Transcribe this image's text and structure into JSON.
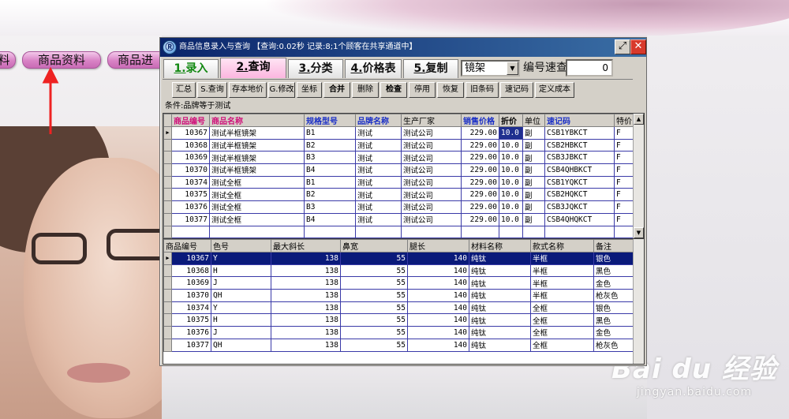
{
  "background": {
    "nav_buttons": [
      "料",
      "商品资料",
      "商品进"
    ],
    "watermark_text": "Bai du 经验",
    "watermark_url": "jingyan.baidu.com"
  },
  "window": {
    "title": "商品信息录入与查询  【查询:0.02秒  记录:8;1个顾客在共享通道中】",
    "icon": "app-logo-icon",
    "controls": {
      "restore": "restore-icon",
      "close": "close-icon"
    }
  },
  "tabs": [
    {
      "num": "1.",
      "label": "录入"
    },
    {
      "num": "2.",
      "label": "查询"
    },
    {
      "num": "3.",
      "label": "分类"
    },
    {
      "num": "4.",
      "label": "价格表"
    },
    {
      "num": "5.",
      "label": "复制"
    }
  ],
  "category_combo": {
    "value": "镜架"
  },
  "quick_search": {
    "label": "编号速查",
    "value": "0"
  },
  "toolbar": [
    {
      "name": "summary-button",
      "label": "汇总"
    },
    {
      "name": "query-button",
      "label": "S.查询"
    },
    {
      "name": "save-cost-button",
      "label": "存本地价"
    },
    {
      "name": "modify-button",
      "label": "G.修改"
    },
    {
      "name": "coordinate-button",
      "label": "坐标"
    },
    {
      "name": "merge-button",
      "label": "合并"
    },
    {
      "name": "delete-button",
      "label": "删除"
    },
    {
      "name": "check-button",
      "label": "检查"
    },
    {
      "name": "disable-button",
      "label": "停用"
    },
    {
      "name": "restore-button",
      "label": "恢复"
    },
    {
      "name": "old-barcode-button",
      "label": "旧条码"
    },
    {
      "name": "quick-code-button",
      "label": "速记码"
    },
    {
      "name": "define-cost-button",
      "label": "定义成本"
    }
  ],
  "condition": "条件:品牌等于测试",
  "top_grid": {
    "headers": [
      "商品编号",
      "商品名称",
      "规格型号",
      "品牌名称",
      "生产厂家",
      "销售价格",
      "折价",
      "单位",
      "速记码",
      "特价"
    ],
    "rows": [
      [
        "10367",
        "测试半框镜架",
        "B1",
        "测试",
        "测试公司",
        "229.00",
        "10.0",
        "副",
        "CSB1YBKCT",
        "F"
      ],
      [
        "10368",
        "测试半框镜架",
        "B2",
        "测试",
        "测试公司",
        "229.00",
        "10.0",
        "副",
        "CSB2HBKCT",
        "F"
      ],
      [
        "10369",
        "测试半框镜架",
        "B3",
        "测试",
        "测试公司",
        "229.00",
        "10.0",
        "副",
        "CSB3JBKCT",
        "F"
      ],
      [
        "10370",
        "测试半框镜架",
        "B4",
        "测试",
        "测试公司",
        "229.00",
        "10.0",
        "副",
        "CSB4QHBKCT",
        "F"
      ],
      [
        "10374",
        "测试全框",
        "B1",
        "测试",
        "测试公司",
        "229.00",
        "10.0",
        "副",
        "CSB1YQKCT",
        "F"
      ],
      [
        "10375",
        "测试全框",
        "B2",
        "测试",
        "测试公司",
        "229.00",
        "10.0",
        "副",
        "CSB2HQKCT",
        "F"
      ],
      [
        "10376",
        "测试全框",
        "B3",
        "测试",
        "测试公司",
        "229.00",
        "10.0",
        "副",
        "CSB3JQKCT",
        "F"
      ],
      [
        "10377",
        "测试全框",
        "B4",
        "测试",
        "测试公司",
        "229.00",
        "10.0",
        "副",
        "CSB4QHQKCT",
        "F"
      ]
    ]
  },
  "bottom_grid": {
    "headers": [
      "商品编号",
      "色号",
      "最大斜长",
      "鼻宽",
      "腿长",
      "材料名称",
      "款式名称",
      "备注"
    ],
    "rows": [
      [
        "10367",
        "Y",
        "138",
        "55",
        "140",
        "纯钛",
        "半框",
        "银色"
      ],
      [
        "10368",
        "H",
        "138",
        "55",
        "140",
        "纯钛",
        "半框",
        "黑色"
      ],
      [
        "10369",
        "J",
        "138",
        "55",
        "140",
        "纯钛",
        "半框",
        "金色"
      ],
      [
        "10370",
        "QH",
        "138",
        "55",
        "140",
        "纯钛",
        "半框",
        "枪灰色"
      ],
      [
        "10374",
        "Y",
        "138",
        "55",
        "140",
        "纯钛",
        "全框",
        "银色"
      ],
      [
        "10375",
        "H",
        "138",
        "55",
        "140",
        "纯钛",
        "全框",
        "黑色"
      ],
      [
        "10376",
        "J",
        "138",
        "55",
        "140",
        "纯钛",
        "全框",
        "金色"
      ],
      [
        "10377",
        "QH",
        "138",
        "55",
        "140",
        "纯钛",
        "全框",
        "枪灰色"
      ]
    ]
  },
  "colors": {
    "title_start": "#0a246a",
    "title_end": "#3a6ea5",
    "active_tab": "#fbb6df",
    "grid_line": "#3a3aa8",
    "header_pink": "#d0107a",
    "header_blue": "#1a2fc7",
    "selection": "#0a1a7a",
    "annotation_arrow": "#ee2222"
  }
}
